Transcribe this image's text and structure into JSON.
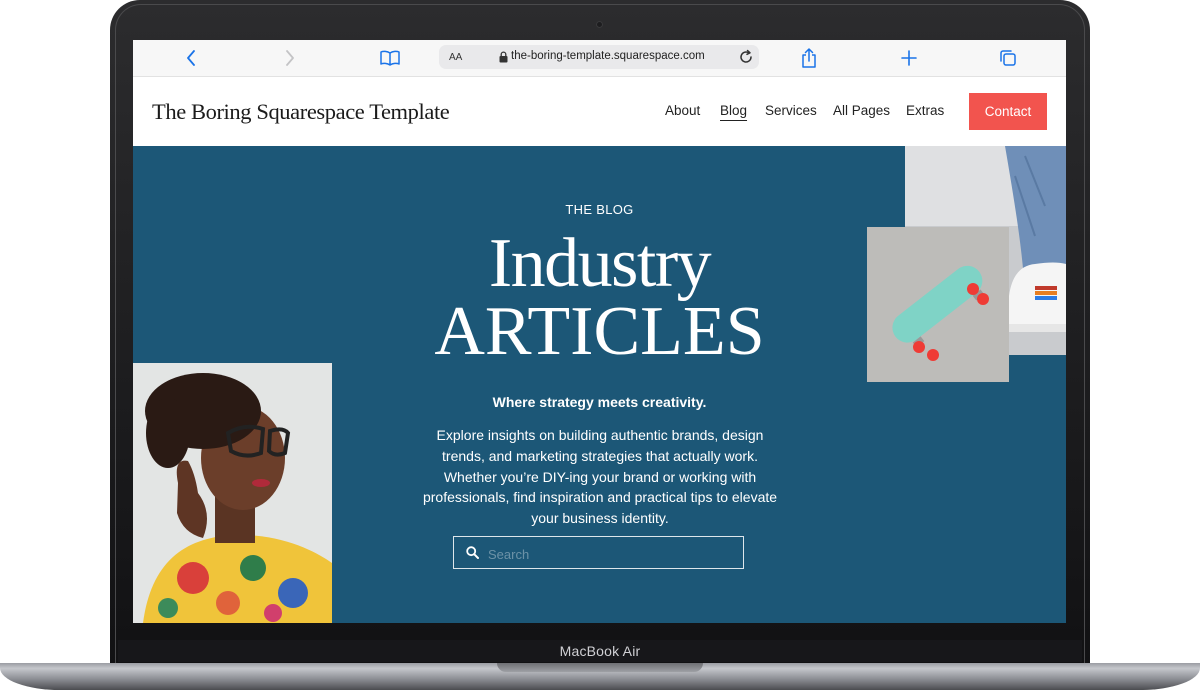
{
  "device": {
    "label": "MacBook Air"
  },
  "browser": {
    "text_size_label": "AA",
    "url": "the-boring-template.squarespace.com"
  },
  "site": {
    "title": "The Boring Squarespace Template",
    "nav": [
      {
        "label": "About"
      },
      {
        "label": "Blog",
        "active": true
      },
      {
        "label": "Services"
      },
      {
        "label": "All Pages"
      },
      {
        "label": "Extras"
      }
    ],
    "cta_label": "Contact"
  },
  "hero": {
    "eyebrow": "THE BLOG",
    "headline_line1": "Industry",
    "headline_line2": "ARTICLES",
    "tagline": "Where strategy meets creativity.",
    "description": "Explore insights on building authentic brands, design trends, and marketing strategies that actually work. Whether you’re DIY-ing your brand or working with professionals, find inspiration and practical tips to elevate your business identity.",
    "search_placeholder": "Search"
  },
  "colors": {
    "hero_background": "#1c5777",
    "cta_background": "#f2544e",
    "browser_accent": "#1a73e8"
  }
}
